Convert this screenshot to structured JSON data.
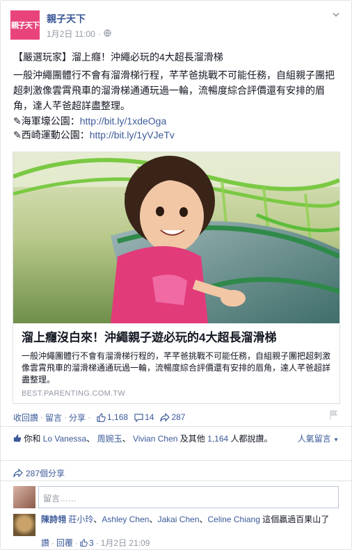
{
  "header": {
    "logo_text": "親子天下",
    "page_name": "親子天下",
    "date": "1月2日 11:00",
    "audience_sep": "·"
  },
  "post": {
    "title": "【嚴選玩家】溜上癮！沖繩必玩的4大超長溜滑梯",
    "body": "一般沖繩團體行不會有溜滑梯行程，芊芊爸挑戰不可能任務，自組親子團把超刺激像雲霄飛車的溜滑梯通通玩過一輪，流暢度綜合評價還有安排的眉角，達人芊爸超詳盡整理。",
    "links": [
      {
        "label": "✎海軍壕公園：",
        "url": "http://bit.ly/1xdeOga"
      },
      {
        "label": "✎西崎運動公園：",
        "url": "http://bit.ly/1yVJeTv"
      }
    ]
  },
  "attachment": {
    "title": "溜上癮沒白來！沖繩親子遊必玩的4大超長溜滑梯",
    "description": "一般沖繩團體行不會有溜滑梯行程的，芊芊爸挑戰不可能任務，自組親子團把超刺激像雲霄飛車的溜滑梯通通玩過一輪，流暢度綜合評價還有安排的眉角，達人芊爸超詳盡整理。",
    "domain": "BEST.PARENTING.COM.TW"
  },
  "actions": {
    "read_more": "收回讚",
    "comment": "留言",
    "share": "分享",
    "sep": "·",
    "like_count": "1,168",
    "comment_count": "14",
    "share_count": "287"
  },
  "likes": {
    "prefix": "你和",
    "names": [
      "Lo Vanessa",
      "周婉玉",
      "Vivian Chen"
    ],
    "sep": "、",
    "mid": "及其他",
    "others_count": "1,164",
    "suffix": "人都說讚。",
    "sort_label": "人氣留言"
  },
  "shares": {
    "label": "287個分享"
  },
  "comment_input": {
    "placeholder": "留言……"
  },
  "comment": {
    "author": "陳詩翎",
    "tags": [
      "莊小玲",
      "Ashley Chen",
      "Jakai Chen",
      "Celine Chiang"
    ],
    "tag_sep": "、",
    "text": "這個贏過百果山了",
    "like": "讚",
    "reply": "回覆",
    "like_count": "3",
    "date": "1月2日 21:09",
    "sep": "·"
  },
  "colors": {
    "link": "#3b5998",
    "logo_bg": "#e8447b",
    "muted": "#9197a3"
  }
}
